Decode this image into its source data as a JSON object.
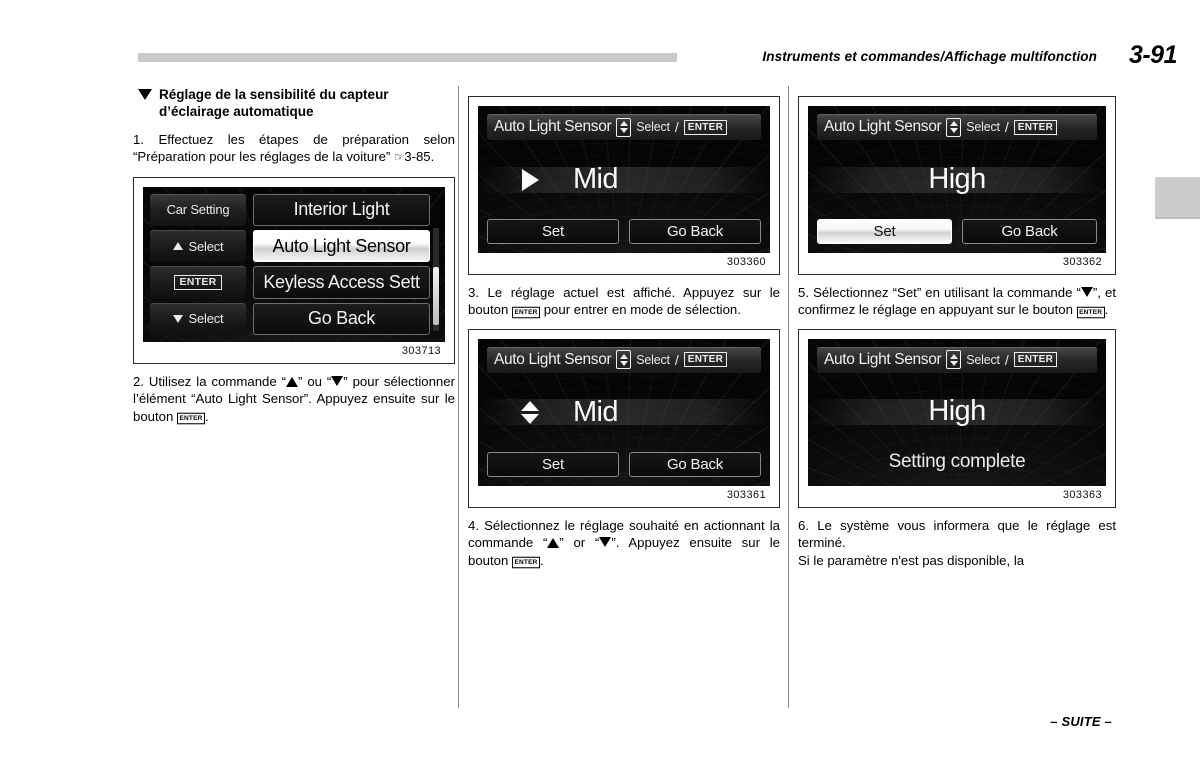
{
  "header": {
    "title": "Instruments et commandes/Affichage multifonction",
    "page_number": "3-91"
  },
  "footer": {
    "continued": "– SUITE –"
  },
  "column_1": {
    "heading_line1": "Réglage de la sensibilité du capteur",
    "heading_line2": "d’éclairage automatique",
    "step1_a": "1.  Effectuez les étapes de préparation selon “Préparation pour les réglages de la voiture” ",
    "step1_hand": "☞",
    "step1_b": "3-85.",
    "figure": {
      "id": "303713",
      "left_buttons": [
        {
          "label": "Car Setting",
          "icon": "none"
        },
        {
          "label": "Select",
          "icon": "arrow-up"
        },
        {
          "label": "ENTER",
          "icon": "enter-box"
        },
        {
          "label": "Select",
          "icon": "arrow-down"
        }
      ],
      "menu_items": [
        {
          "label": "Interior Light",
          "selected": false
        },
        {
          "label": "Auto Light Sensor",
          "selected": true
        },
        {
          "label": "Keyless Access Sett",
          "selected": false
        },
        {
          "label": "Go Back",
          "selected": false
        }
      ]
    },
    "step2_a": "2.  Utilisez la commande “",
    "step2_b": "” ou “",
    "step2_c": "” pour sélectionner l’élément “Auto Light Sensor”. Appuyez ensuite sur le bouton ",
    "step2_enter": "ENTER",
    "step2_d": "."
  },
  "column_2": {
    "figure_top": {
      "id": "303360",
      "title_name": "Auto Light Sensor",
      "title_select": "Select",
      "title_slash": "/",
      "title_enter": "ENTER",
      "value": "Mid",
      "cursor": "right-triangle",
      "buttons": [
        {
          "label": "Set",
          "selected": false
        },
        {
          "label": "Go Back",
          "selected": false
        }
      ]
    },
    "step3_a": "3.   Le réglage actuel est affiché. Appuyez sur le bouton ",
    "step3_enter": "ENTER",
    "step3_b": " pour entrer en mode de sélection.",
    "figure_bottom": {
      "id": "303361",
      "title_name": "Auto Light Sensor",
      "title_select": "Select",
      "title_slash": "/",
      "title_enter": "ENTER",
      "value": "Mid",
      "cursor": "up-down-triangles",
      "buttons": [
        {
          "label": "Set",
          "selected": false
        },
        {
          "label": "Go Back",
          "selected": false
        }
      ]
    },
    "step4_a": "4.  Sélectionnez le réglage souhaité en actionnant la commande “",
    "step4_b": "” or “",
    "step4_c": "”. Appuyez ensuite sur le bouton ",
    "step4_enter": "ENTER",
    "step4_d": "."
  },
  "column_3": {
    "figure_top": {
      "id": "303362",
      "title_name": "Auto Light Sensor",
      "title_select": "Select",
      "title_slash": "/",
      "title_enter": "ENTER",
      "value": "High",
      "cursor": "none",
      "buttons": [
        {
          "label": "Set",
          "selected": true
        },
        {
          "label": "Go Back",
          "selected": false
        }
      ]
    },
    "step5_a": "5.  Sélectionnez “Set” en utilisant la commande “",
    "step5_b": "”, et confirmez le réglage en appuyant sur le bouton ",
    "step5_enter": "ENTER",
    "step5_c": ".",
    "figure_bottom": {
      "id": "303363",
      "title_name": "Auto Light Sensor",
      "title_select": "Select",
      "title_slash": "/",
      "title_enter": "ENTER",
      "value": "High",
      "cursor": "none",
      "status": "Setting complete",
      "buttons": []
    },
    "step6_a": "6.  Le système vous informera que le réglage est terminé.",
    "step6_b": "Si le paramètre n'est pas disponible, la"
  }
}
